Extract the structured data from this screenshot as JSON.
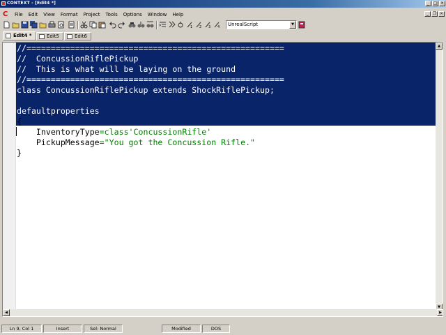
{
  "window": {
    "title": "CONTEXT - [Edit4 *]"
  },
  "menu": {
    "logo": "C",
    "items": [
      {
        "label": "File"
      },
      {
        "label": "Edit"
      },
      {
        "label": "View"
      },
      {
        "label": "Format"
      },
      {
        "label": "Project"
      },
      {
        "label": "Tools"
      },
      {
        "label": "Options"
      },
      {
        "label": "Window"
      },
      {
        "label": "Help"
      }
    ]
  },
  "toolbar": {
    "language_selected": "UnrealScript",
    "icons": [
      "new-file-icon",
      "open-file-icon",
      "save-icon",
      "save-all-icon",
      "close-file-icon",
      "print-icon",
      "print-preview-icon",
      "cut-icon",
      "copy-icon",
      "paste-icon",
      "undo-icon",
      "redo-icon",
      "find-icon",
      "find-replace-icon",
      "find-next-icon",
      "indent-icon",
      "bookmark-icon",
      "execute-icon",
      "user-tool-1-icon",
      "user-tool-2-icon",
      "user-tool-3-icon",
      "user-tool-4-icon",
      "help-book-icon"
    ]
  },
  "tabs": [
    {
      "label": "Edit4 *",
      "active": true
    },
    {
      "label": "Edit5",
      "active": false
    },
    {
      "label": "Edit6",
      "active": false
    }
  ],
  "editor": {
    "lines": [
      {
        "text": "//=====================================================",
        "selected": true
      },
      {
        "text": "//  ConcussionRiflePickup",
        "selected": true
      },
      {
        "text": "//  This is what will be laying on the ground",
        "selected": true
      },
      {
        "text": "//=====================================================",
        "selected": true
      },
      {
        "text": "class ConcussionRiflePickup extends ShockRiflePickup;",
        "selected": true
      },
      {
        "text": "",
        "selected": true
      },
      {
        "text": "defaultproperties",
        "selected": true
      },
      {
        "text": "{",
        "selected": false
      },
      {
        "text": "    InventoryType=class'ConcussionRifle'",
        "selected": false
      },
      {
        "text": "    PickupMessage=\"You got the Concussion Rifle.\"",
        "selected": false
      },
      {
        "text": "}",
        "selected": false
      }
    ],
    "line9": {
      "key": "    InventoryType",
      "eq": "=",
      "value": "class'ConcussionRifle'"
    },
    "line10": {
      "key": "    PickupMessage",
      "eq": "=",
      "value": "\"You got the Concussion Rifle.\""
    }
  },
  "status": {
    "position": "Ln 9, Col 1",
    "mode": "Insert",
    "selection": "Sel: Normal",
    "modified": "Modified",
    "format": "DOS"
  },
  "colors": {
    "selection_bg": "#0a246a",
    "string_color": "#008000",
    "logo_color": "#d01010"
  }
}
